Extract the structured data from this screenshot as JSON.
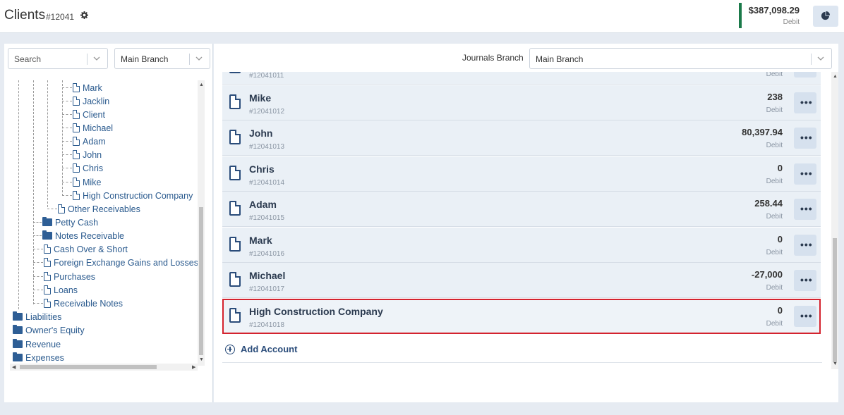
{
  "header": {
    "title": "Clients",
    "id": "#12041",
    "balance_amount": "$387,098.29",
    "balance_type": "Debit"
  },
  "left": {
    "search_placeholder": "Search",
    "branch_select": "Main Branch",
    "tree": {
      "clients": [
        "Mark",
        "Jacklin",
        "Client",
        "Michael",
        "Adam",
        "John",
        "Chris",
        "Mike",
        "High Construction Company"
      ],
      "other_receivables": "Other Receivables",
      "petty_cash": "Petty Cash",
      "notes_receivable": "Notes Receivable",
      "cash_over_short": "Cash Over & Short",
      "fx_gains": "Foreign Exchange Gains and Losses",
      "purchases": "Purchases",
      "loans": "Loans",
      "receivable_notes": "Receivable Notes",
      "liabilities": "Liabilities",
      "owners_equity": "Owner's Equity",
      "revenue": "Revenue",
      "expenses": "Expenses"
    }
  },
  "right": {
    "journals_branch_label": "Journals Branch",
    "journals_branch_value": "Main Branch",
    "partial_row": {
      "id": "#12041011",
      "type": "Debit"
    },
    "rows": [
      {
        "name": "Mike",
        "id": "#12041012",
        "amount": "238",
        "type": "Debit"
      },
      {
        "name": "John",
        "id": "#12041013",
        "amount": "80,397.94",
        "type": "Debit"
      },
      {
        "name": "Chris",
        "id": "#12041014",
        "amount": "0",
        "type": "Debit"
      },
      {
        "name": "Adam",
        "id": "#12041015",
        "amount": "258.44",
        "type": "Debit"
      },
      {
        "name": "Mark",
        "id": "#12041016",
        "amount": "0",
        "type": "Debit"
      },
      {
        "name": "Michael",
        "id": "#12041017",
        "amount": "-27,000",
        "type": "Debit"
      },
      {
        "name": "High Construction Company",
        "id": "#12041018",
        "amount": "0",
        "type": "Debit"
      }
    ],
    "menu_label": "•••",
    "add_account": "Add Account"
  },
  "colors": {
    "accent_green": "#1b7a4a",
    "link_blue": "#2a5a8e",
    "selected_border": "#d4232e"
  }
}
